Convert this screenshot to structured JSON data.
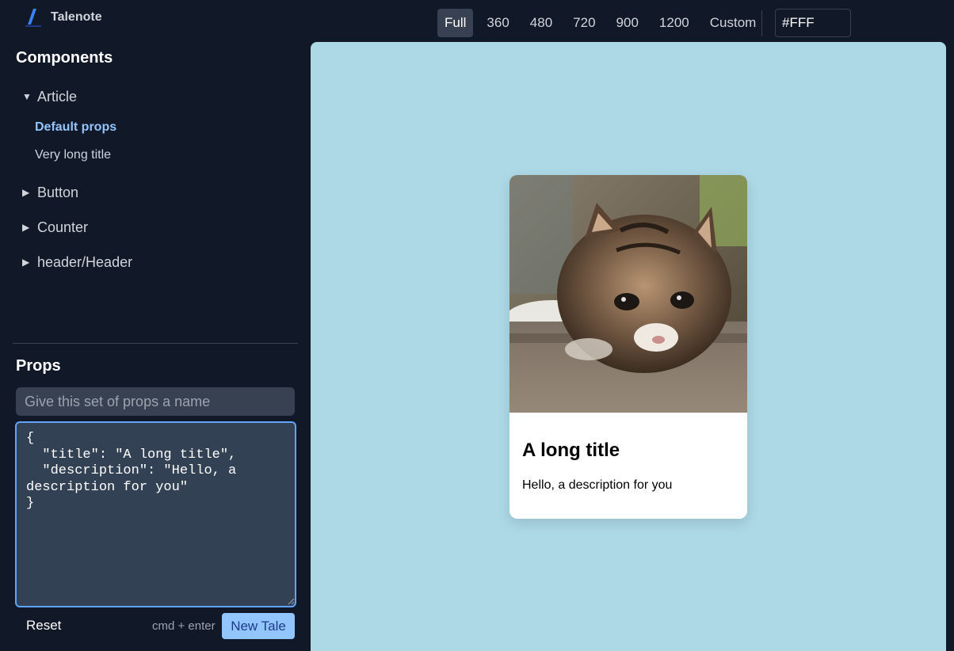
{
  "app": {
    "name": "Talenote"
  },
  "sidebar": {
    "components_title": "Components",
    "tree": [
      {
        "label": "Article",
        "expanded": true,
        "children": [
          "Default props",
          "Very long title"
        ],
        "active_child": "Default props"
      },
      {
        "label": "Button",
        "expanded": false
      },
      {
        "label": "Counter",
        "expanded": false
      },
      {
        "label": "header/Header",
        "expanded": false
      }
    ],
    "props_title": "Props",
    "name_placeholder": "Give this set of props a name",
    "props_json": "{\n  \"title\": \"A long title\",\n  \"description\": \"Hello, a description for you\"\n}",
    "reset_label": "Reset",
    "shortcut_hint": "cmd + enter",
    "new_tale_label": "New Tale"
  },
  "toolbar": {
    "sizes": [
      "Full",
      "360",
      "480",
      "720",
      "900",
      "1200",
      "Custom"
    ],
    "active_size": "Full",
    "background_value": "#FFF"
  },
  "preview": {
    "canvas_color": "#add8e6",
    "card": {
      "image": "kitten photo",
      "title": "A long title",
      "description": "Hello, a description for you"
    }
  },
  "colors": {
    "accent": "#93c5fd",
    "focus_border": "#60a5fa",
    "panel": "#111827"
  }
}
